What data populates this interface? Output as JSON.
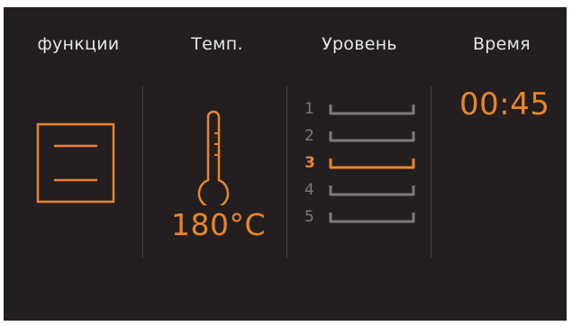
{
  "headers": {
    "functions": "функции",
    "temperature": "Темп.",
    "level": "Уровень",
    "time": "Время"
  },
  "function": {
    "icon": "top-bottom-heat-icon"
  },
  "temperature": {
    "icon": "thermometer-icon",
    "value": "180°C"
  },
  "levels": [
    {
      "label": "1",
      "active": false
    },
    {
      "label": "2",
      "active": false
    },
    {
      "label": "3",
      "active": true
    },
    {
      "label": "4",
      "active": false
    },
    {
      "label": "5",
      "active": false
    }
  ],
  "time": {
    "value": "00:45"
  },
  "colors": {
    "background": "#231f20",
    "accent": "#e8862c",
    "header_text": "#e6e6e6",
    "inactive": "#7d7a7b",
    "divider": "#4a4647"
  }
}
